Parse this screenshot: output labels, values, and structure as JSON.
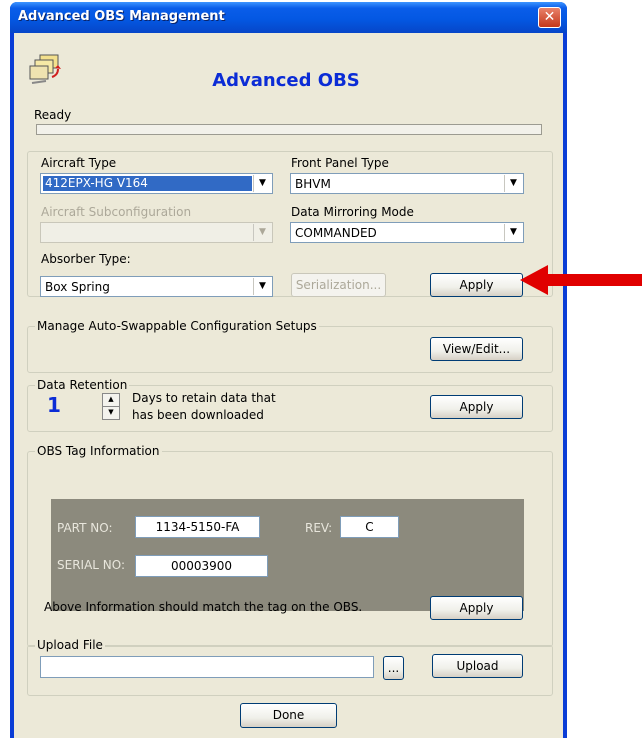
{
  "window": {
    "title": "Advanced OBS Management",
    "app_title": "Advanced OBS",
    "status": "Ready",
    "progress": 0
  },
  "config": {
    "aircraft_type_label": "Aircraft Type",
    "aircraft_type_value": "412EPX-HG V164",
    "front_panel_label": "Front Panel Type",
    "front_panel_value": "BHVM",
    "subconfig_label": "Aircraft Subconfiguration",
    "subconfig_value": "",
    "mirroring_label": "Data Mirroring Mode",
    "mirroring_value": "COMMANDED",
    "absorber_label": "Absorber Type:",
    "absorber_value": "Box Spring",
    "serialization_button": "Serialization...",
    "apply_button": "Apply"
  },
  "auto_swap": {
    "group_label": "Manage Auto-Swappable Configuration Setups",
    "view_edit_button": "View/Edit..."
  },
  "retention": {
    "group_label": "Data Retention",
    "days_value": "1",
    "description_line1": "Days to retain data that",
    "description_line2": "has been downloaded",
    "apply_button": "Apply"
  },
  "tag": {
    "group_label": "OBS Tag Information",
    "part_no_label": "PART NO:",
    "part_no_value": "1134-5150-FA",
    "rev_label": "REV:",
    "rev_value": "C",
    "serial_no_label": "SERIAL NO:",
    "serial_no_value": "00003900",
    "note": "Above Information should match the tag on the OBS.",
    "apply_button": "Apply"
  },
  "upload": {
    "group_label": "Upload File",
    "path_value": "",
    "browse_button": "...",
    "upload_button": "Upload"
  },
  "footer": {
    "done_button": "Done"
  },
  "colors": {
    "title_blue": "#0b2cd6",
    "selection": "#316ac5",
    "annotation_arrow": "#e00000"
  },
  "icons": {
    "app_icon": "folders-sync-icon",
    "close": "close-icon",
    "dropdown": "chevron-down-icon"
  }
}
